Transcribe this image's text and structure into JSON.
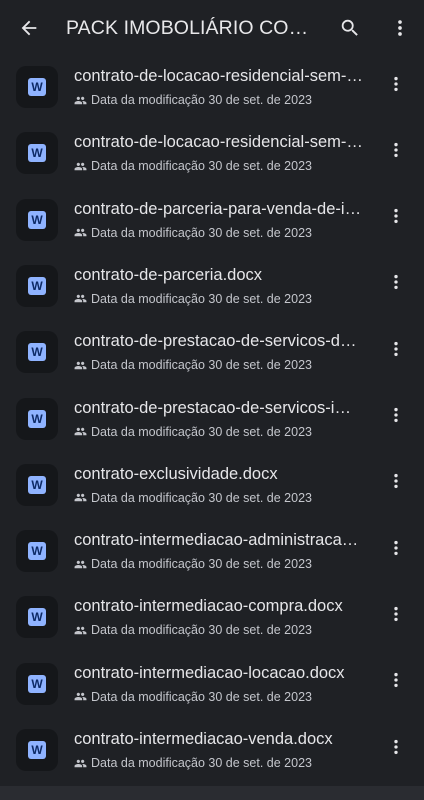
{
  "appbar": {
    "title": "PACK IMOBOLIÁRIO CONTRATOS"
  },
  "files": [
    {
      "name": "contrato-de-locacao-residencial-sem-fiador.docx",
      "meta": "Data da modificação 30 de set. de 2023",
      "icon": "word-doc-icon"
    },
    {
      "name": "contrato-de-locacao-residencial-sem-garantia.docx",
      "meta": "Data da modificação 30 de set. de 2023",
      "icon": "word-doc-icon"
    },
    {
      "name": "contrato-de-parceria-para-venda-de-imovel.docx",
      "meta": "Data da modificação 30 de set. de 2023",
      "icon": "word-doc-icon"
    },
    {
      "name": "contrato-de-parceria.docx",
      "meta": "Data da modificação 30 de set. de 2023",
      "icon": "word-doc-icon"
    },
    {
      "name": "contrato-de-prestacao-de-servicos-de-corretagem.docx",
      "meta": "Data da modificação 30 de set. de 2023",
      "icon": "word-doc-icon"
    },
    {
      "name": "contrato-de-prestacao-de-servicos-imobiliarios.docx",
      "meta": "Data da modificação 30 de set. de 2023",
      "icon": "word-doc-icon"
    },
    {
      "name": "contrato-exclusividade.docx",
      "meta": "Data da modificação 30 de set. de 2023",
      "icon": "word-doc-icon"
    },
    {
      "name": "contrato-intermediacao-administracao.docx",
      "meta": "Data da modificação 30 de set. de 2023",
      "icon": "word-doc-icon"
    },
    {
      "name": "contrato-intermediacao-compra.docx",
      "meta": "Data da modificação 30 de set. de 2023",
      "icon": "word-doc-icon"
    },
    {
      "name": "contrato-intermediacao-locacao.docx",
      "meta": "Data da modificação 30 de set. de 2023",
      "icon": "word-doc-icon"
    },
    {
      "name": "contrato-intermediacao-venda.docx",
      "meta": "Data da modificação 30 de set. de 2023",
      "icon": "word-doc-icon"
    }
  ],
  "icon_letter": "W",
  "colors": {
    "background": "#1f2125",
    "word_badge": "#8fb3ff",
    "text_primary": "#e6e6e9",
    "text_secondary": "#c4c6cc"
  }
}
